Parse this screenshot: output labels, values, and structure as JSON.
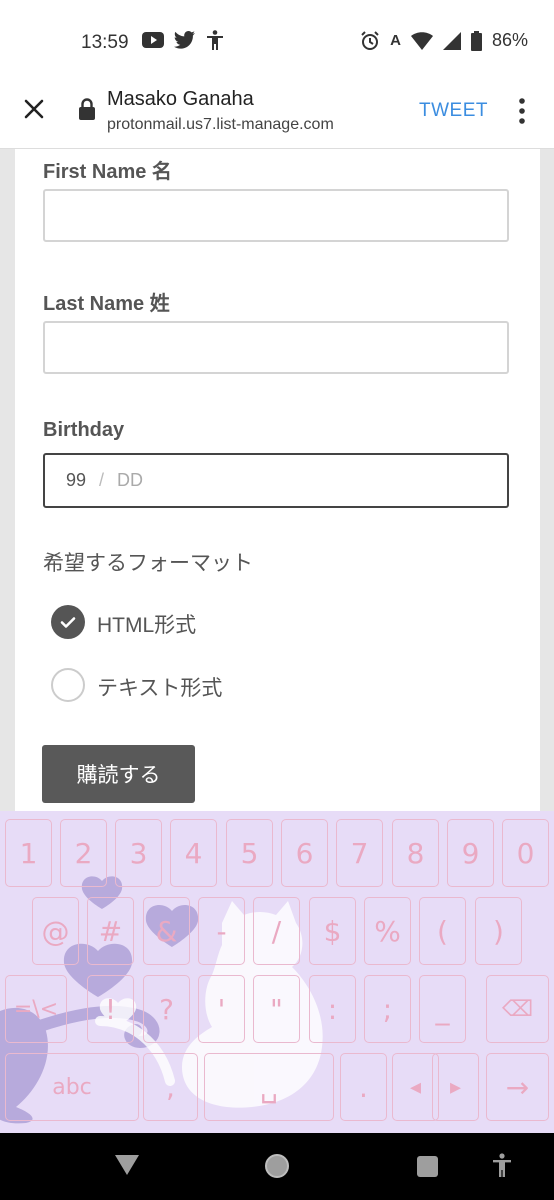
{
  "status_bar": {
    "time": "13:59",
    "keyboard_indicator": "A",
    "battery": "86%",
    "left_icons": [
      "youtube-icon",
      "twitter-icon",
      "accessibility-icon"
    ],
    "right_icons": [
      "alarm-icon",
      "wifi-icon",
      "signal-icon",
      "battery-icon"
    ]
  },
  "toolbar": {
    "title": "Masako Ganaha",
    "url": "protonmail.us7.list-manage.com",
    "action_label": "TWEET"
  },
  "form": {
    "first_name_label": "First Name 名",
    "first_name_value": "",
    "last_name_label": "Last Name 姓",
    "last_name_value": "",
    "birthday_label": "Birthday",
    "birthday_month_value": "99",
    "birthday_separator": "/",
    "birthday_day_placeholder": "DD",
    "format_label": "希望するフォーマット",
    "format_options": [
      {
        "label": "HTML形式",
        "selected": true
      },
      {
        "label": "テキスト形式",
        "selected": false
      }
    ],
    "submit_label": "購読する"
  },
  "keyboard": {
    "row1": [
      "1",
      "2",
      "3",
      "4",
      "5",
      "6",
      "7",
      "8",
      "9",
      "0"
    ],
    "row2": [
      "@",
      "#",
      "&",
      "-",
      "/",
      "$",
      "%",
      "(",
      ")"
    ],
    "row3": [
      "=\\<",
      "!",
      "?",
      "'",
      "\"",
      ":",
      ";",
      "_",
      "⌫"
    ],
    "row4": [
      "abc",
      ",",
      "␣",
      ".",
      "◂",
      "▸",
      "→"
    ],
    "theme_colors": {
      "background": "#e7dcf7",
      "key_text": "#eaa9c2",
      "decoration": "#a89ad3"
    }
  },
  "nav_bar": {
    "icons": [
      "back-icon",
      "home-icon",
      "recents-icon",
      "accessibility-icon"
    ]
  }
}
